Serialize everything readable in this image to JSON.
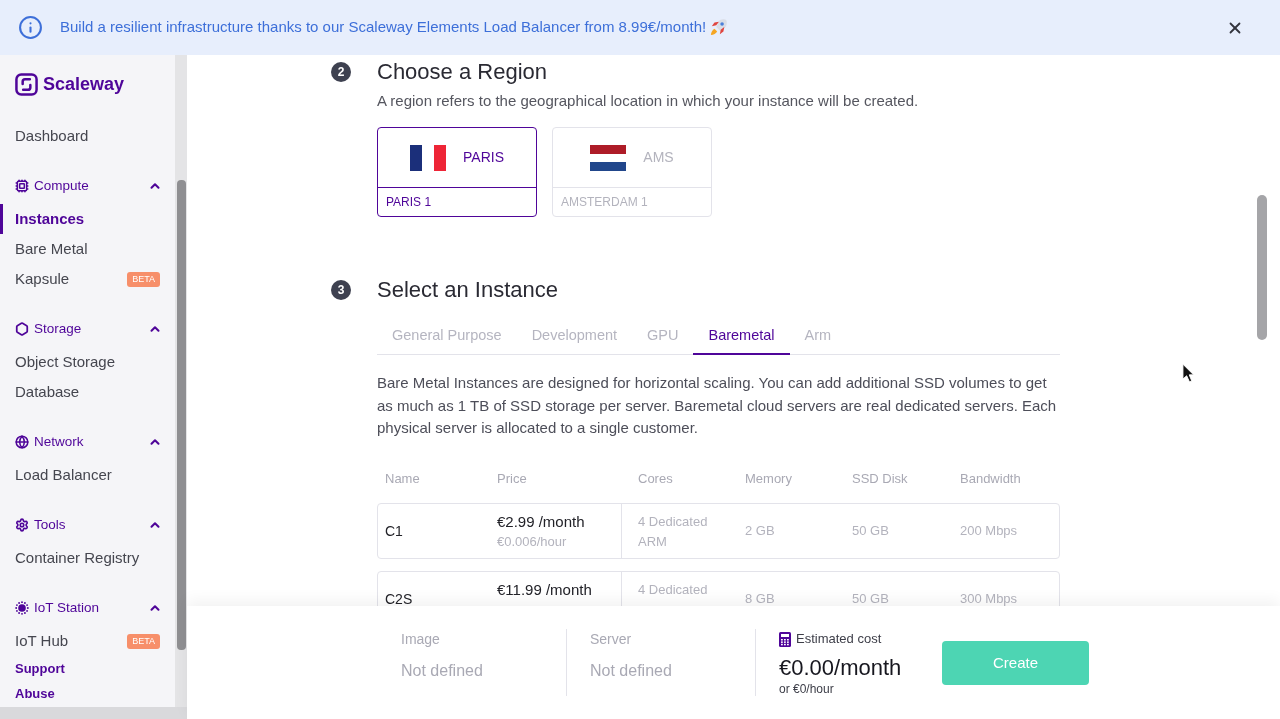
{
  "banner": {
    "text": "Build a resilient infrastructure thanks to our Scaleway Elements Load Balancer from 8.99€/month!"
  },
  "sidebar": {
    "logo": "Scaleway",
    "items": [
      {
        "kind": "link",
        "label": "Dashboard",
        "selected": false
      },
      {
        "kind": "group",
        "label": "Compute",
        "expanded": true,
        "children": [
          {
            "label": "Instances",
            "selected": true
          },
          {
            "label": "Bare Metal",
            "selected": false
          },
          {
            "label": "Kapsule",
            "selected": false,
            "badge": "BETA"
          }
        ]
      },
      {
        "kind": "group",
        "label": "Storage",
        "expanded": true,
        "children": [
          {
            "label": "Object Storage",
            "selected": false
          },
          {
            "label": "Database",
            "selected": false
          }
        ]
      },
      {
        "kind": "group",
        "label": "Network",
        "expanded": true,
        "children": [
          {
            "label": "Load Balancer",
            "selected": false
          }
        ]
      },
      {
        "kind": "group",
        "label": "Tools",
        "expanded": true,
        "children": [
          {
            "label": "Container Registry",
            "selected": false
          }
        ]
      },
      {
        "kind": "group",
        "label": "IoT Station",
        "expanded": true,
        "children": [
          {
            "label": "IoT Hub",
            "selected": false,
            "badge": "BETA"
          }
        ]
      }
    ],
    "links": [
      "Support",
      "Abuse"
    ]
  },
  "steps": [
    {
      "kind": "regions",
      "number": "2",
      "title": "Choose a Region",
      "description": "A region refers to the geographical location in which your instance will be created.",
      "regions": [
        {
          "code": "PARIS",
          "name": "PARIS 1",
          "selected": true
        },
        {
          "code": "AMS",
          "name": "AMSTERDAM 1",
          "selected": false
        }
      ]
    },
    {
      "kind": "instances",
      "number": "3",
      "title": "Select an Instance",
      "tabs": [
        {
          "label": "General Purpose",
          "selected": false
        },
        {
          "label": "Development",
          "selected": false
        },
        {
          "label": "GPU",
          "selected": false
        },
        {
          "label": "Baremetal",
          "selected": true
        },
        {
          "label": "Arm",
          "selected": false
        }
      ],
      "description": "Bare Metal Instances are designed for horizontal scaling. You can add additional SSD volumes to get as much as 1 TB of SSD storage per server. Baremetal cloud servers are real dedicated servers. Each physical server is allocated to a single customer.",
      "table": {
        "columns": [
          "Name",
          "Price",
          "Cores",
          "Memory",
          "SSD Disk",
          "Bandwidth"
        ],
        "rows": [
          {
            "name": "C1",
            "price": "€2.99 /month",
            "hourly": "€0.006/hour",
            "cores": "4 Dedicated ARM",
            "memory": "2 GB",
            "ssd": "50 GB",
            "bandwidth": "200 Mbps"
          },
          {
            "name": "C2S",
            "price": "€11.99 /month",
            "cores": "4 Dedicated",
            "memory": "8 GB",
            "ssd": "50 GB",
            "bandwidth": "300 Mbps"
          }
        ]
      }
    }
  ],
  "footer": {
    "summary": [
      {
        "label": "Image",
        "value": "Not defined"
      },
      {
        "label": "Server",
        "value": "Not defined"
      }
    ],
    "estimate": {
      "label": "Estimated cost",
      "monthly": "€0.00/month",
      "hourly": "or €0/hour"
    },
    "create_button": "Create"
  }
}
